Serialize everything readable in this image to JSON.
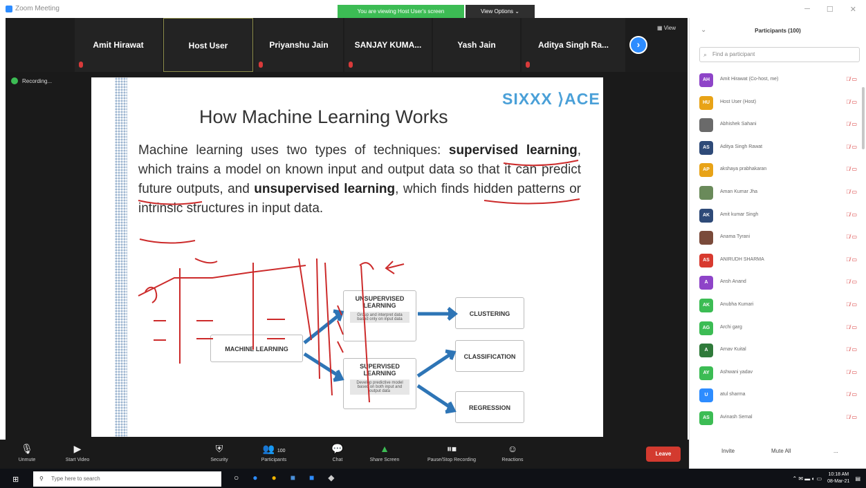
{
  "window": {
    "title": "Zoom Meeting",
    "share_banner": "You are viewing Host User's screen",
    "view_options": "View Options ⌄"
  },
  "video_strip": {
    "tiles": [
      "Amit Hirawat",
      "Host User",
      "Priyanshu Jain",
      "SANJAY  KUMA...",
      "Yash Jain",
      "Aditya Singh Ra..."
    ],
    "view_label": "View"
  },
  "recording": {
    "label": "Recording...",
    "controls": "❚❚  ■"
  },
  "slide": {
    "brand": "SIXXX ⟩ACE",
    "title": "How Machine Learning Works",
    "para_parts": [
      "Machine learning uses two types of techniques: ",
      "supervised learning",
      ", which trains a model on known input and output data so that it can predict future outputs, and ",
      "unsupervised learning",
      ", which finds hidden patterns or intrinsic structures in input data."
    ],
    "diagram": {
      "ml": "MACHINE LEARNING",
      "unsup": "UNSUPERVISED LEARNING",
      "unsup_desc": "Group and interpret data based only on input data",
      "sup": "SUPERVISED LEARNING",
      "sup_desc": "Develop predictive model based on both input and output data",
      "clustering": "CLUSTERING",
      "classification": "CLASSIFICATION",
      "regression": "REGRESSION"
    }
  },
  "toolbar": {
    "unmute": "Unmute",
    "start_video": "Start Video",
    "security": "Security",
    "participants": "Participants",
    "participants_count": "100",
    "chat": "Chat",
    "share_screen": "Share Screen",
    "pause_recording": "Pause/Stop Recording",
    "reactions": "Reactions",
    "leave": "Leave"
  },
  "participants_panel": {
    "title": "Participants (100)",
    "search_placeholder": "Find a participant",
    "participants": [
      {
        "initials": "AH",
        "name": "Amit Hirawat (Co-host, me)",
        "color": "#8e44c8"
      },
      {
        "initials": "HU",
        "name": "Host User (Host)",
        "color": "#e8a317"
      },
      {
        "initials": "",
        "name": "Abhishek Sahani",
        "color": "#6a6a6a"
      },
      {
        "initials": "AS",
        "name": "Aditya Singh Rawat",
        "color": "#2e4a78"
      },
      {
        "initials": "AP",
        "name": "akshaya prabhakaran",
        "color": "#e8a317"
      },
      {
        "initials": "",
        "name": "Aman Kumar Jha",
        "color": "#6a8a5a"
      },
      {
        "initials": "AK",
        "name": "Amit kumar Singh",
        "color": "#2e4a78"
      },
      {
        "initials": "",
        "name": "Anama Tyrani",
        "color": "#7a4a3a"
      },
      {
        "initials": "AS",
        "name": "ANIRUDH SHARMA",
        "color": "#d83a2f"
      },
      {
        "initials": "A",
        "name": "Ansh Anand",
        "color": "#8e44c8"
      },
      {
        "initials": "AK",
        "name": "Anubha Kumari",
        "color": "#3cbc54"
      },
      {
        "initials": "AG",
        "name": "Archi garg",
        "color": "#3cbc54"
      },
      {
        "initials": "A",
        "name": "Arnav Kuital",
        "color": "#2f7a3a"
      },
      {
        "initials": "AY",
        "name": "Ashwani yadav",
        "color": "#3cbc54"
      },
      {
        "initials": "U",
        "name": "atul sharma",
        "color": "#2d8cff"
      },
      {
        "initials": "AS",
        "name": "Avinash Semal",
        "color": "#3cbc54"
      }
    ],
    "invite": "Invite",
    "mute_all": "Mute All",
    "more": "..."
  },
  "taskbar": {
    "search_placeholder": "Type here to search",
    "time": "10:18 AM",
    "date": "08-Mar-21"
  }
}
